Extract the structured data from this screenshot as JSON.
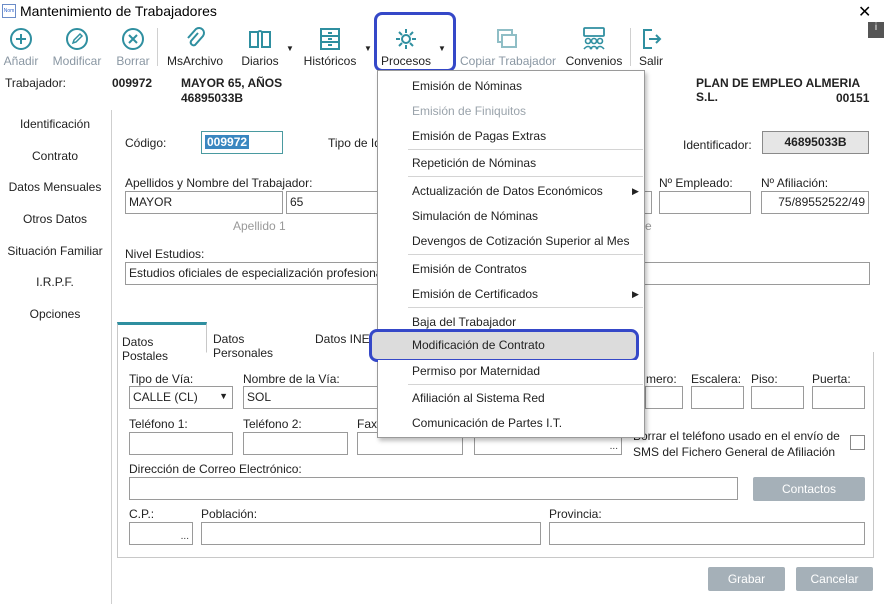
{
  "window": {
    "title": "Mantenimiento de Trabajadores",
    "app_icon_text": "Nom"
  },
  "toolbar": {
    "anadir": "Añadir",
    "modificar": "Modificar",
    "borrar": "Borrar",
    "msarchivo": "MsArchivo",
    "diarios": "Diarios",
    "historicos": "Históricos",
    "procesos": "Procesos",
    "copiar": "Copiar Trabajador",
    "convenios": "Convenios",
    "salir": "Salir"
  },
  "worker": {
    "label": "Trabajador:",
    "code": "009972",
    "name": "MAYOR 65, AÑOS",
    "id": "46895033B",
    "company": "PLAN DE EMPLEO ALMERIA S.L.",
    "company_code": "00151"
  },
  "sidebar": {
    "items": [
      {
        "label": "Identificación"
      },
      {
        "label": "Contrato"
      },
      {
        "label": "Datos Mensuales"
      },
      {
        "label": "Otros Datos"
      },
      {
        "label": "Situación Familiar"
      },
      {
        "label": "I.R.P.F."
      },
      {
        "label": "Opciones"
      }
    ]
  },
  "form": {
    "codigo_label": "Código:",
    "codigo_value": "009972",
    "tipo_label": "Tipo de Id",
    "identificador_label": "Identificador:",
    "identificador_value": "46895033B",
    "apellidos_label": "Apellidos y Nombre del Trabajador:",
    "apellido1_value": "MAYOR",
    "apellido2_value": "65",
    "apellido1_hint": "Apellido 1",
    "hint_e": "e",
    "n_empleado_label": "Nº Empleado:",
    "n_afiliacion_label": "Nº Afiliación:",
    "n_afiliacion_value": "75/89552522/49",
    "nivel_label": "Nivel Estudios:",
    "nivel_value": "Estudios oficiales de especialización profesional"
  },
  "tabs": {
    "postales": "Datos Postales",
    "personales": "Datos Personales",
    "inem": "Datos INEM"
  },
  "postales": {
    "tipo_via_label": "Tipo de Vía:",
    "tipo_via_value": "CALLE (CL)",
    "nombre_via_label": "Nombre de la Vía:",
    "nombre_via_value": "SOL",
    "numero_label": "mero:",
    "escalera_label": "Escalera:",
    "piso_label": "Piso:",
    "puerta_label": "Puerta:",
    "tel1_label": "Teléfono 1:",
    "tel2_label": "Teléfono 2:",
    "fax_label": "Fax",
    "sms_text_1": "Borrar el teléfono usado en el envío de",
    "sms_text_2": "SMS del Fichero General de Afiliación",
    "email_label": "Dirección de Correo Electrónico:",
    "contactos": "Contactos",
    "cp_label": "C.P.:",
    "poblacion_label": "Población:",
    "provincia_label": "Provincia:",
    "ellipsis": "..."
  },
  "actions": {
    "grabar": "Grabar",
    "cancelar": "Cancelar"
  },
  "menu": {
    "items": [
      {
        "label": "Emisión de Nóminas"
      },
      {
        "label": "Emisión de Finiquitos"
      },
      {
        "label": "Emisión de Pagas Extras"
      },
      {
        "label": "Repetición de Nóminas"
      },
      {
        "label": "Actualización de Datos Económicos"
      },
      {
        "label": "Simulación de Nóminas"
      },
      {
        "label": "Devengos de Cotización Superior al Mes"
      },
      {
        "label": "Emisión de Contratos"
      },
      {
        "label": "Emisión de Certificados"
      },
      {
        "label": "Baja del Trabajador"
      },
      {
        "label": "Modificación de Contrato"
      },
      {
        "label": "Permiso por Maternidad"
      },
      {
        "label": "Afiliación al Sistema Red"
      },
      {
        "label": "Comunicación de Partes I.T."
      }
    ]
  },
  "colors": {
    "accent_ring": "#3548c8",
    "icon_teal": "#2f8fa0",
    "selection": "#3a87c0"
  }
}
